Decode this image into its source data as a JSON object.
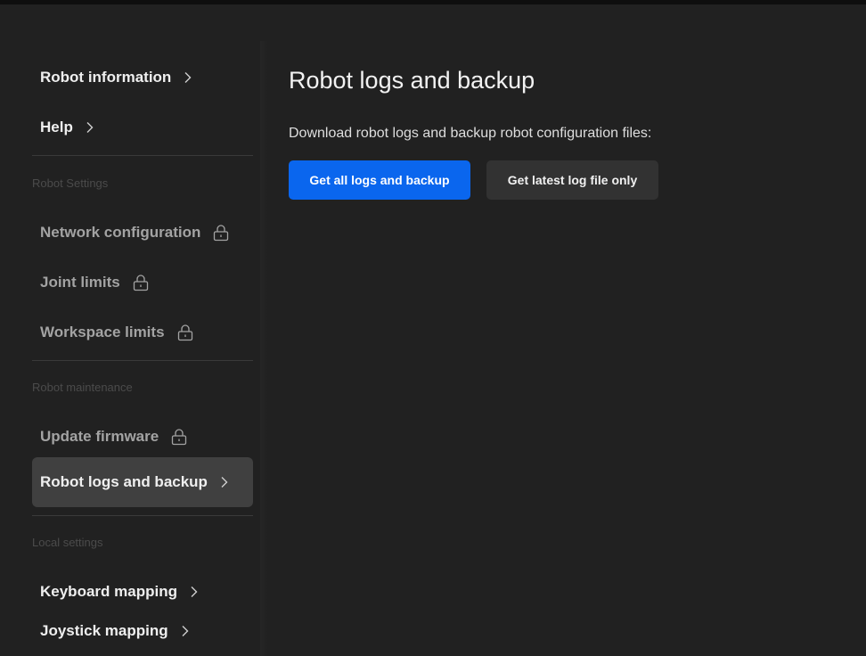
{
  "sidebar": {
    "top_items": [
      {
        "label": "Robot information",
        "icon": "chevron-right-icon"
      },
      {
        "label": "Help",
        "icon": "chevron-right-icon"
      }
    ],
    "sections": [
      {
        "label": "Robot Settings",
        "items": [
          {
            "label": "Network configuration",
            "icon": "lock-icon"
          },
          {
            "label": "Joint limits",
            "icon": "lock-icon"
          },
          {
            "label": "Workspace limits",
            "icon": "lock-icon"
          }
        ]
      },
      {
        "label": "Robot maintenance",
        "items": [
          {
            "label": "Update firmware",
            "icon": "lock-icon"
          },
          {
            "label": "Robot logs and backup",
            "icon": "chevron-right-icon",
            "active": true
          }
        ]
      },
      {
        "label": "Local settings",
        "items": [
          {
            "label": "Keyboard mapping",
            "icon": "chevron-right-icon"
          },
          {
            "label": "Joystick mapping",
            "icon": "chevron-right-icon"
          }
        ]
      }
    ]
  },
  "main": {
    "title": "Robot logs and backup",
    "description": "Download robot logs and backup robot configuration files:",
    "primary_button": "Get all logs and backup",
    "secondary_button": "Get latest log file only"
  },
  "colors": {
    "background": "#212121",
    "accent": "#0a66ee",
    "active_item": "#404040",
    "secondary_button": "#323232"
  }
}
